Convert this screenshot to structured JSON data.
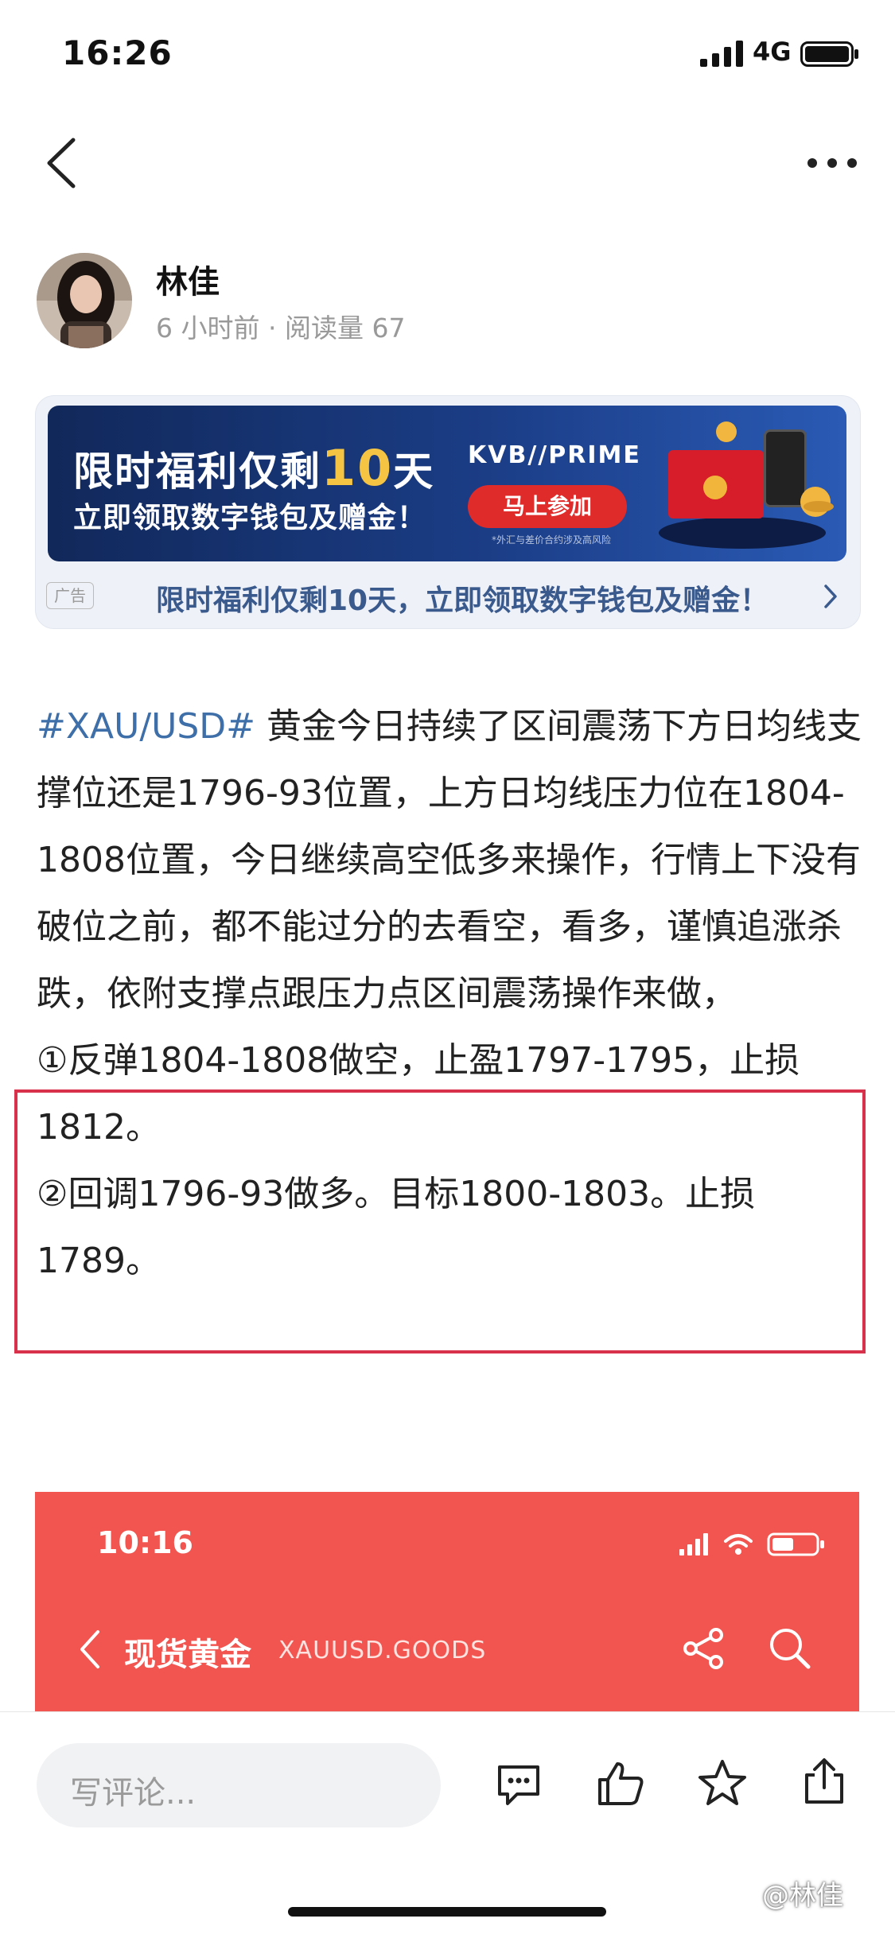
{
  "status_bar": {
    "time": "16:26",
    "network": "4G"
  },
  "nav": {
    "back_icon": "chevron-left-icon",
    "more_icon": "more-horizontal-icon"
  },
  "author": {
    "name": "林佳",
    "meta": "6 小时前 · 阅读量 67"
  },
  "ad": {
    "headline_pre": "限时福利仅剩",
    "headline_num": "10",
    "headline_post": "天",
    "subline": "立即领取数字钱包及赠金！",
    "brand": "KVB//PRIME",
    "button": "马上参加",
    "fine_print": "*外汇与差价合约涉及高风险",
    "tag": "广告",
    "caption": "限时福利仅剩10天，立即领取数字钱包及赠金！"
  },
  "article": {
    "hashtag": "#XAU/USD#",
    "paragraph": " 黄金今日持续了区间震荡下方日均线支撑位还是1796-93位置，上方日均线压力位在1804-1808位置，今日继续高空低多来操作，行情上下没有破位之前，都不能过分的去看空，看多，谨慎追涨杀跌，依附支撑点跟压力点区间震荡操作来做，",
    "item1": "①反弹1804-1808做空，止盈1797-1795，止损1812。",
    "item2": "②回调1796-93做多。目标1800-1803。止损1789。",
    "highlight_color": "#d8314b"
  },
  "embedded_screenshot": {
    "time": "10:16",
    "title": "现货黄金",
    "code": "XAUUSD.GOODS",
    "background": "#f2544f"
  },
  "bottom_bar": {
    "comment_placeholder": "写评论..."
  },
  "watermark": "@林佳",
  "colors": {
    "link": "#3f6fa8",
    "ad_caption": "#3a5a8e",
    "meta": "#999999"
  }
}
